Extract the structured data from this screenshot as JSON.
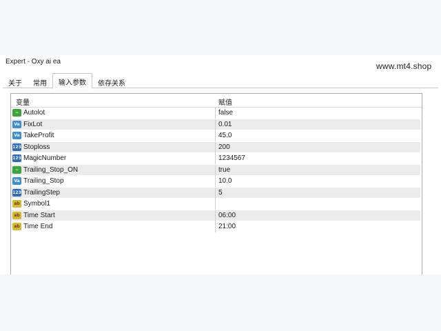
{
  "window": {
    "title": "Expert - Oxy ai ea",
    "watermark": "www.mt4.shop"
  },
  "tabs": [
    {
      "label": "关于",
      "active": false
    },
    {
      "label": "常用",
      "active": false
    },
    {
      "label": "输入参数",
      "active": true
    },
    {
      "label": "依存关系",
      "active": false
    }
  ],
  "grid": {
    "header_variable": "变量",
    "header_value": "赋值"
  },
  "params": [
    {
      "icon": "bool-param-icon",
      "name": "Autolot",
      "value": "false"
    },
    {
      "icon": "double-param-icon",
      "name": "FixLot",
      "value": "0.01"
    },
    {
      "icon": "double-param-icon",
      "name": "TakeProfit",
      "value": "45.0"
    },
    {
      "icon": "int-param-icon",
      "name": "Stoploss",
      "value": "200"
    },
    {
      "icon": "int-param-icon",
      "name": "MagicNumber",
      "value": "1234567"
    },
    {
      "icon": "bool-param-icon",
      "name": "Trailing_Stop_ON",
      "value": "true"
    },
    {
      "icon": "double-param-icon",
      "name": "Trailing_Stop",
      "value": "10.0"
    },
    {
      "icon": "int-param-icon",
      "name": "TrailingStep",
      "value": "5"
    },
    {
      "icon": "string-param-icon",
      "name": "Symbol1",
      "value": ""
    },
    {
      "icon": "string-param-icon",
      "name": "Time Start",
      "value": "06:00"
    },
    {
      "icon": "string-param-icon",
      "name": "Time End",
      "value": "21:00"
    }
  ]
}
